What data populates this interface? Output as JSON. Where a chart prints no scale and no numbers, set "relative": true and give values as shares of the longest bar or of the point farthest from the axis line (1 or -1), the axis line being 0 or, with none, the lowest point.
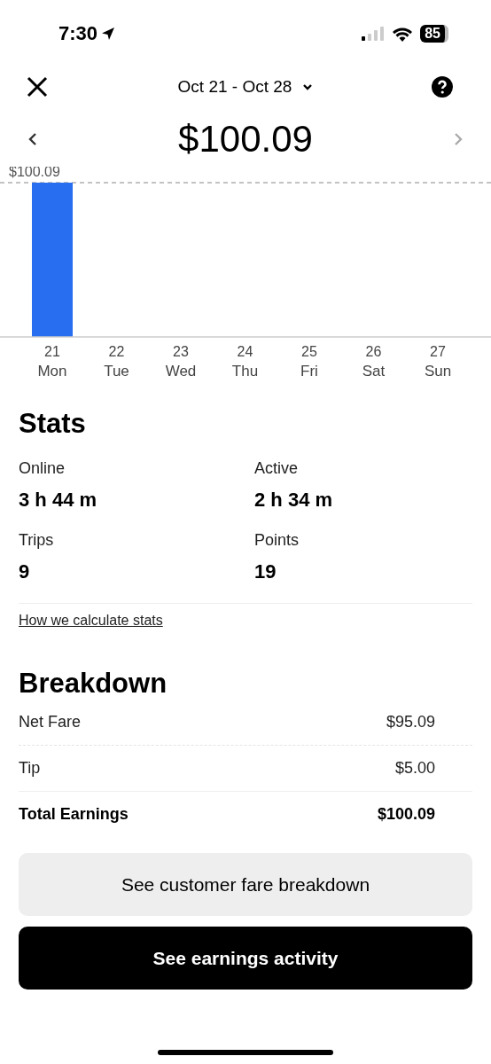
{
  "status_bar": {
    "time": "7:30",
    "battery": "85"
  },
  "header": {
    "period": "Oct 21 - Oct 28",
    "total": "$100.09"
  },
  "chart_data": {
    "type": "bar",
    "categories": [
      "21 Mon",
      "22 Tue",
      "23 Wed",
      "24 Thu",
      "25 Fri",
      "26 Sat",
      "27 Sun"
    ],
    "series": [
      {
        "color": "#276ef1",
        "values": [
          1,
          0,
          0,
          0,
          0,
          0,
          0
        ]
      }
    ],
    "relative": true,
    "annotations": [
      {
        "text": "$100.09",
        "y": 1
      }
    ]
  },
  "stats": {
    "title": "Stats",
    "items": [
      {
        "label": "Online",
        "value": "3 h 44 m"
      },
      {
        "label": "Active",
        "value": "2 h 34 m"
      },
      {
        "label": "Trips",
        "value": "9"
      },
      {
        "label": "Points",
        "value": "19"
      }
    ],
    "link": "How we calculate stats"
  },
  "breakdown": {
    "title": "Breakdown",
    "rows": [
      {
        "label": "Net Fare",
        "amount": "$95.09",
        "kind": "line"
      },
      {
        "label": "Tip",
        "amount": "$5.00",
        "kind": "line"
      },
      {
        "label": "Total Earnings",
        "amount": "$100.09",
        "kind": "total"
      }
    ]
  },
  "buttons": [
    {
      "label": "See customer fare breakdown",
      "kind": "secondary"
    },
    {
      "label": "See earnings activity",
      "kind": "primary"
    }
  ]
}
